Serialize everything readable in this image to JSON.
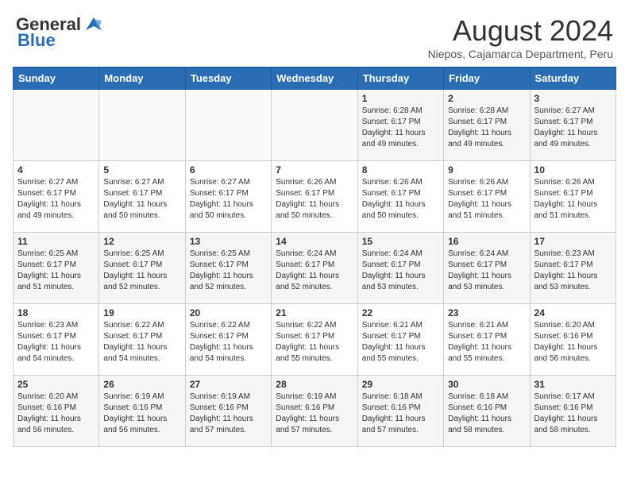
{
  "header": {
    "logo_line1": "General",
    "logo_line2": "Blue",
    "month_year": "August 2024",
    "location": "Niepos, Cajamarca Department, Peru"
  },
  "days_of_week": [
    "Sunday",
    "Monday",
    "Tuesday",
    "Wednesday",
    "Thursday",
    "Friday",
    "Saturday"
  ],
  "weeks": [
    [
      {
        "day": "",
        "info": ""
      },
      {
        "day": "",
        "info": ""
      },
      {
        "day": "",
        "info": ""
      },
      {
        "day": "",
        "info": ""
      },
      {
        "day": "1",
        "info": "Sunrise: 6:28 AM\nSunset: 6:17 PM\nDaylight: 11 hours\nand 49 minutes."
      },
      {
        "day": "2",
        "info": "Sunrise: 6:28 AM\nSunset: 6:17 PM\nDaylight: 11 hours\nand 49 minutes."
      },
      {
        "day": "3",
        "info": "Sunrise: 6:27 AM\nSunset: 6:17 PM\nDaylight: 11 hours\nand 49 minutes."
      }
    ],
    [
      {
        "day": "4",
        "info": "Sunrise: 6:27 AM\nSunset: 6:17 PM\nDaylight: 11 hours\nand 49 minutes."
      },
      {
        "day": "5",
        "info": "Sunrise: 6:27 AM\nSunset: 6:17 PM\nDaylight: 11 hours\nand 50 minutes."
      },
      {
        "day": "6",
        "info": "Sunrise: 6:27 AM\nSunset: 6:17 PM\nDaylight: 11 hours\nand 50 minutes."
      },
      {
        "day": "7",
        "info": "Sunrise: 6:26 AM\nSunset: 6:17 PM\nDaylight: 11 hours\nand 50 minutes."
      },
      {
        "day": "8",
        "info": "Sunrise: 6:26 AM\nSunset: 6:17 PM\nDaylight: 11 hours\nand 50 minutes."
      },
      {
        "day": "9",
        "info": "Sunrise: 6:26 AM\nSunset: 6:17 PM\nDaylight: 11 hours\nand 51 minutes."
      },
      {
        "day": "10",
        "info": "Sunrise: 6:26 AM\nSunset: 6:17 PM\nDaylight: 11 hours\nand 51 minutes."
      }
    ],
    [
      {
        "day": "11",
        "info": "Sunrise: 6:25 AM\nSunset: 6:17 PM\nDaylight: 11 hours\nand 51 minutes."
      },
      {
        "day": "12",
        "info": "Sunrise: 6:25 AM\nSunset: 6:17 PM\nDaylight: 11 hours\nand 52 minutes."
      },
      {
        "day": "13",
        "info": "Sunrise: 6:25 AM\nSunset: 6:17 PM\nDaylight: 11 hours\nand 52 minutes."
      },
      {
        "day": "14",
        "info": "Sunrise: 6:24 AM\nSunset: 6:17 PM\nDaylight: 11 hours\nand 52 minutes."
      },
      {
        "day": "15",
        "info": "Sunrise: 6:24 AM\nSunset: 6:17 PM\nDaylight: 11 hours\nand 53 minutes."
      },
      {
        "day": "16",
        "info": "Sunrise: 6:24 AM\nSunset: 6:17 PM\nDaylight: 11 hours\nand 53 minutes."
      },
      {
        "day": "17",
        "info": "Sunrise: 6:23 AM\nSunset: 6:17 PM\nDaylight: 11 hours\nand 53 minutes."
      }
    ],
    [
      {
        "day": "18",
        "info": "Sunrise: 6:23 AM\nSunset: 6:17 PM\nDaylight: 11 hours\nand 54 minutes."
      },
      {
        "day": "19",
        "info": "Sunrise: 6:22 AM\nSunset: 6:17 PM\nDaylight: 11 hours\nand 54 minutes."
      },
      {
        "day": "20",
        "info": "Sunrise: 6:22 AM\nSunset: 6:17 PM\nDaylight: 11 hours\nand 54 minutes."
      },
      {
        "day": "21",
        "info": "Sunrise: 6:22 AM\nSunset: 6:17 PM\nDaylight: 11 hours\nand 55 minutes."
      },
      {
        "day": "22",
        "info": "Sunrise: 6:21 AM\nSunset: 6:17 PM\nDaylight: 11 hours\nand 55 minutes."
      },
      {
        "day": "23",
        "info": "Sunrise: 6:21 AM\nSunset: 6:17 PM\nDaylight: 11 hours\nand 55 minutes."
      },
      {
        "day": "24",
        "info": "Sunrise: 6:20 AM\nSunset: 6:16 PM\nDaylight: 11 hours\nand 56 minutes."
      }
    ],
    [
      {
        "day": "25",
        "info": "Sunrise: 6:20 AM\nSunset: 6:16 PM\nDaylight: 11 hours\nand 56 minutes."
      },
      {
        "day": "26",
        "info": "Sunrise: 6:19 AM\nSunset: 6:16 PM\nDaylight: 11 hours\nand 56 minutes."
      },
      {
        "day": "27",
        "info": "Sunrise: 6:19 AM\nSunset: 6:16 PM\nDaylight: 11 hours\nand 57 minutes."
      },
      {
        "day": "28",
        "info": "Sunrise: 6:19 AM\nSunset: 6:16 PM\nDaylight: 11 hours\nand 57 minutes."
      },
      {
        "day": "29",
        "info": "Sunrise: 6:18 AM\nSunset: 6:16 PM\nDaylight: 11 hours\nand 57 minutes."
      },
      {
        "day": "30",
        "info": "Sunrise: 6:18 AM\nSunset: 6:16 PM\nDaylight: 11 hours\nand 58 minutes."
      },
      {
        "day": "31",
        "info": "Sunrise: 6:17 AM\nSunset: 6:16 PM\nDaylight: 11 hours\nand 58 minutes."
      }
    ]
  ]
}
